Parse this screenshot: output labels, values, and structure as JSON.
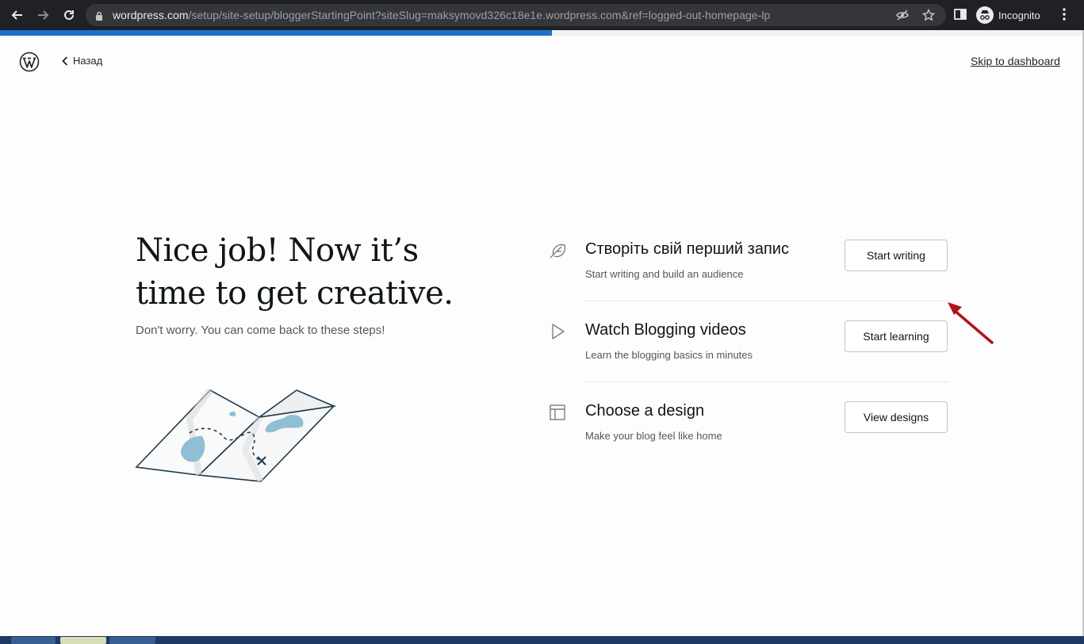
{
  "browser": {
    "url_host": "wordpress.com",
    "url_path": "/setup/site-setup/bloggerStartingPoint?siteSlug=maksymovd326c18e1e.wordpress.com&ref=logged-out-homepage-lp",
    "incognito_label": "Incognito"
  },
  "progress": {
    "fraction": 0.51,
    "color": "#1a73c7"
  },
  "header": {
    "back_label": "Назад",
    "skip_label": "Skip to dashboard"
  },
  "intro": {
    "headline_line1": "Nice job! Now it’s",
    "headline_line2": "time to get creative.",
    "subtitle": "Don't worry. You can come back to these steps!"
  },
  "tasks": [
    {
      "icon": "feather-icon",
      "title": "Створіть свій перший запис",
      "description": "Start writing and build an audience",
      "button": "Start writing"
    },
    {
      "icon": "play-icon",
      "title": "Watch Blogging videos",
      "description": "Learn the blogging basics in minutes",
      "button": "Start learning"
    },
    {
      "icon": "layout-icon",
      "title": "Choose a design",
      "description": "Make your blog feel like home",
      "button": "View designs"
    }
  ],
  "colors": {
    "annotation_arrow": "#b3121b",
    "map_blue": "#8fbfd4",
    "ink": "#1c3a4f"
  }
}
